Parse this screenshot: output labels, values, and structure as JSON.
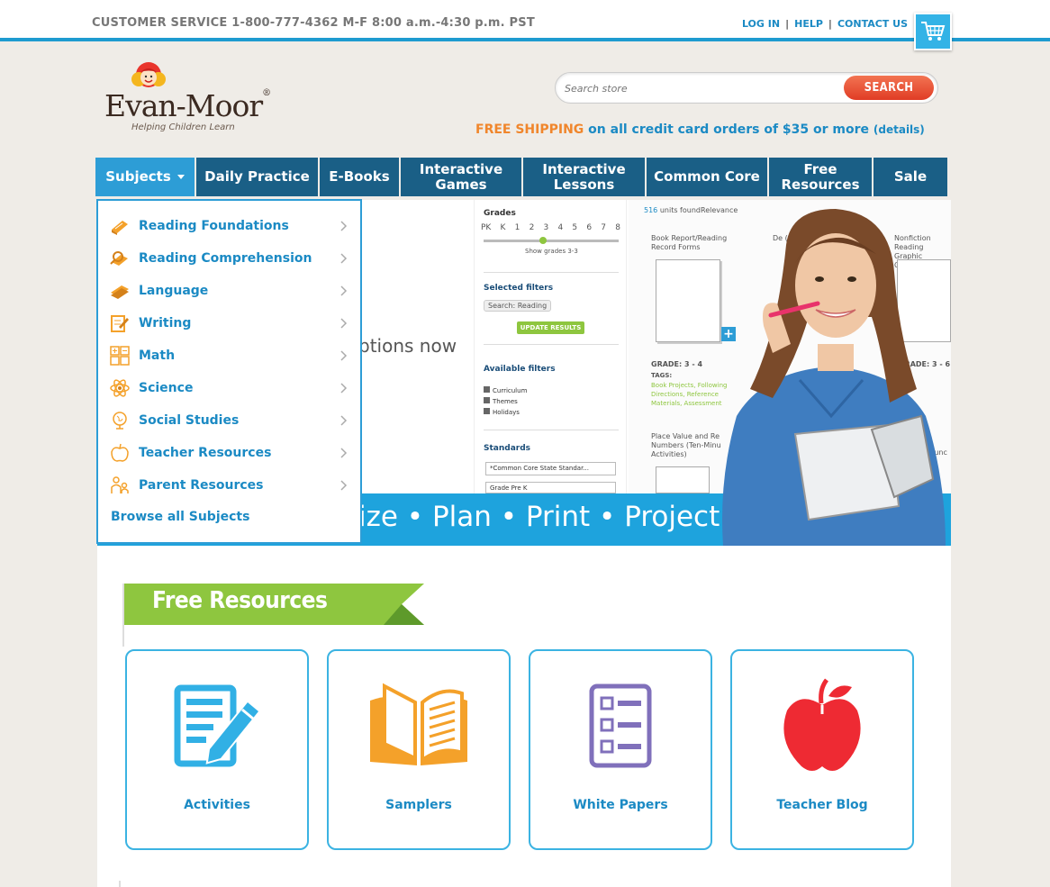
{
  "topbar": {
    "customer_service": "CUSTOMER SERVICE 1-800-777-4362 M-F 8:00 a.m.-4:30 p.m. PST",
    "links": [
      "LOG IN",
      "HELP",
      "CONTACT US"
    ],
    "separator": "|"
  },
  "logo": {
    "name": "Evan-Moor",
    "registered": "®",
    "tagline": "Helping Children Learn"
  },
  "search": {
    "placeholder": "Search store",
    "button": "SEARCH"
  },
  "shipping": {
    "free": "FREE SHIPPING",
    "text": " on all credit card orders of $35 or more ",
    "details": "(details)"
  },
  "nav": [
    {
      "label": "Subjects",
      "active": true
    },
    {
      "label": "Daily Practice"
    },
    {
      "label": "E-Books"
    },
    {
      "label": "Interactive Games"
    },
    {
      "label": "Interactive Lessons"
    },
    {
      "label": "Common Core"
    },
    {
      "label": "Free Resources"
    },
    {
      "label": "Sale"
    }
  ],
  "subjects_menu": {
    "items": [
      {
        "label": "Reading Foundations",
        "icon": "book-icon"
      },
      {
        "label": "Reading Comprehension",
        "icon": "magnifier-book-icon"
      },
      {
        "label": "Language",
        "icon": "books-icon"
      },
      {
        "label": "Writing",
        "icon": "pencil-paper-icon"
      },
      {
        "label": "Math",
        "icon": "calculator-icon"
      },
      {
        "label": "Science",
        "icon": "atom-icon"
      },
      {
        "label": "Social Studies",
        "icon": "globe-icon"
      },
      {
        "label": "Teacher Resources",
        "icon": "apple-icon"
      },
      {
        "label": "Parent Resources",
        "icon": "family-icon"
      }
    ],
    "browse_all": "Browse all Subjects"
  },
  "hero": {
    "partial_text": "ptions now",
    "band_text": "ize • Plan • Print  • Project",
    "filters": {
      "grades_label": "Grades",
      "grade_ticks": [
        "PK",
        "K",
        "1",
        "2",
        "3",
        "4",
        "5",
        "6",
        "7",
        "8"
      ],
      "show_grades": "Show grades 3-3",
      "selected_filters": "Selected filters",
      "search_chip": "Search: Reading",
      "update_results": "UPDATE RESULTS",
      "available_filters": "Available filters",
      "available": [
        "Curriculum",
        "Themes",
        "Holidays"
      ],
      "standards": "Standards",
      "standard_select": "*Common Core State Standar...",
      "grade_select": "Grade Pre K"
    },
    "results": {
      "count": "516",
      "count_label": " units found",
      "sort": "Relevance",
      "item1_title": "Book Report/Reading Record Forms",
      "item1_grade": "GRADE: 3 - 4",
      "item1_tags_label": "TAGS:",
      "item1_tags": "Book Projects, Following Directions, Reference Materials, Assessment",
      "item2_title": "Nonfiction Reading Graphic Organiz",
      "item2_grade": "GRADE: 3 - 6",
      "item3_title": "Place Value and Re Numbers (Ten-Minu Activities)",
      "item_partial_a": "De (E",
      "item_partial_b": "Lunc"
    }
  },
  "free_resources": {
    "title": "Free Resources",
    "cards": [
      {
        "label": "Activities",
        "icon": "worksheet-pencil-icon",
        "color": "#31b0e5"
      },
      {
        "label": "Samplers",
        "icon": "open-book-icon",
        "color": "#f4a12a"
      },
      {
        "label": "White Papers",
        "icon": "checklist-icon",
        "color": "#8070bb"
      },
      {
        "label": "Teacher Blog",
        "icon": "apple-icon",
        "color": "#ee2a33"
      }
    ]
  },
  "colors": {
    "accent": "#1e9bd0",
    "nav": "#1a5f86",
    "nav_active": "#2d9dd6",
    "link": "#1b8ac4",
    "orange": "#f0862c",
    "green": "#8ec63f"
  }
}
